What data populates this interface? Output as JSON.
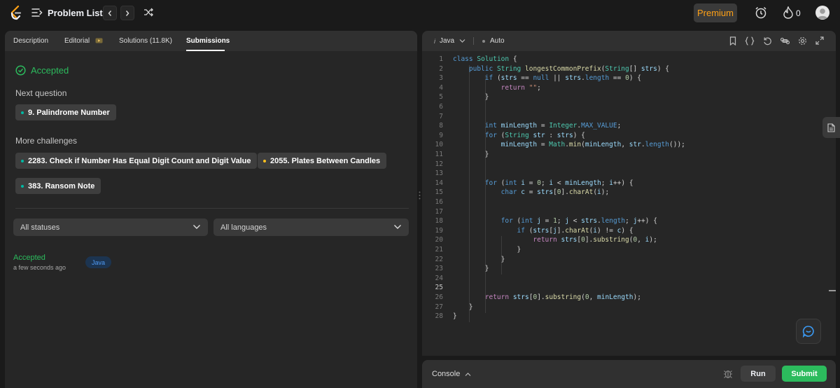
{
  "header": {
    "title": "Problem List",
    "premium_label": "Premium",
    "streak_count": "0",
    "colors": {
      "brand": "#ffa116",
      "success": "#2cbb5d"
    }
  },
  "left": {
    "tabs": [
      {
        "label": "Description"
      },
      {
        "label": "Editorial"
      },
      {
        "label": "Solutions (11.8K)"
      },
      {
        "label": "Submissions"
      }
    ],
    "active_tab": "Submissions",
    "result": "Accepted",
    "next_question_label": "Next question",
    "next_question": "9. Palindrome Number",
    "more_challenges_label": "More challenges",
    "challenges": [
      {
        "title": "2283. Check if Number Has Equal Digit Count and Digit Value",
        "difficulty_color": "#00b8a3"
      },
      {
        "title": "2055. Plates Between Candles",
        "difficulty_color": "#ffc01e"
      },
      {
        "title": "383. Ransom Note",
        "difficulty_color": "#00b8a3"
      }
    ],
    "status_filter": "All statuses",
    "language_filter": "All languages",
    "submission": {
      "status": "Accepted",
      "time": "a few seconds ago",
      "language": "Java"
    }
  },
  "editor": {
    "language": "Java",
    "mode": "Auto",
    "current_line": 25,
    "lines": [
      "class Solution {",
      "    public String longestCommonPrefix(String[] strs) {",
      "        if (strs == null || strs.length == 0) {",
      "            return \"\";",
      "        }",
      "",
      "",
      "        int minLength = Integer.MAX_VALUE;",
      "        for (String str : strs) {",
      "            minLength = Math.min(minLength, str.length());",
      "        }",
      "",
      "",
      "        for (int i = 0; i < minLength; i++) {",
      "            char c = strs[0].charAt(i);",
      "",
      "",
      "            for (int j = 1; j < strs.length; j++) {",
      "                if (strs[j].charAt(i) != c) {",
      "                    return strs[0].substring(0, i);",
      "                }",
      "            }",
      "        }",
      "",
      "",
      "        return strs[0].substring(0, minLength);",
      "    }",
      "}"
    ]
  },
  "console": {
    "label": "Console",
    "run_label": "Run",
    "submit_label": "Submit"
  }
}
